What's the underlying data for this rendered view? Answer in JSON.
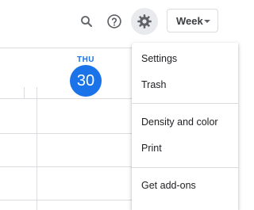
{
  "header": {
    "icons": [
      "search-icon",
      "help-icon",
      "settings-gear-icon"
    ],
    "view_selector": {
      "label": "Week"
    }
  },
  "day": {
    "name": "THU",
    "number": "30",
    "accent": "#1a73e8"
  },
  "settings_menu": {
    "groups": [
      [
        "Settings",
        "Trash"
      ],
      [
        "Density and color",
        "Print"
      ],
      [
        "Get add-ons"
      ]
    ]
  }
}
